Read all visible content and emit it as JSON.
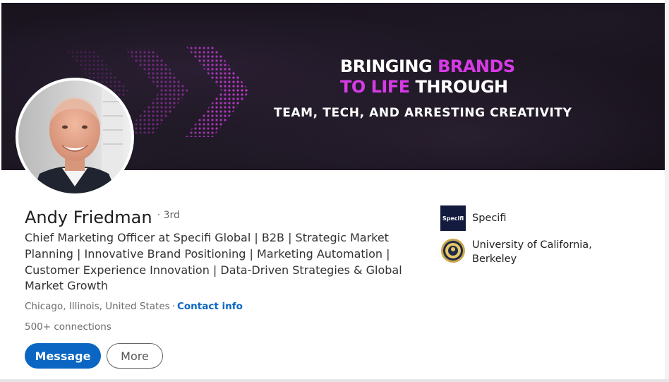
{
  "banner": {
    "headline_part1": "BRINGING ",
    "headline_highlight1": "BRANDS",
    "headline_highlight2": "TO LIFE",
    "headline_part2": " THROUGH",
    "subline": "TEAM, TECH, AND ARRESTING CREATIVITY",
    "accent_color": "#d63be6"
  },
  "profile": {
    "name": "Andy Friedman",
    "degree": "· 3rd",
    "headline": "Chief Marketing Officer at Specifi Global | B2B | Strategic Market Planning | Innovative Brand Positioning | Marketing Automation | Customer Experience Innovation | Data-Driven Strategies & Global Market Growth",
    "location": "Chicago, Illinois, United States",
    "separator": "·",
    "contact_info": "Contact info",
    "connections": "500+ connections"
  },
  "actions": {
    "message_label": "Message",
    "more_label": "More"
  },
  "organizations": {
    "company_logo_text": "Specifi",
    "company_name": "Specifi",
    "school_name": "University of California, Berkeley"
  },
  "colors": {
    "primary_blue": "#0a66c2",
    "banner_bg": "#1a141f"
  }
}
